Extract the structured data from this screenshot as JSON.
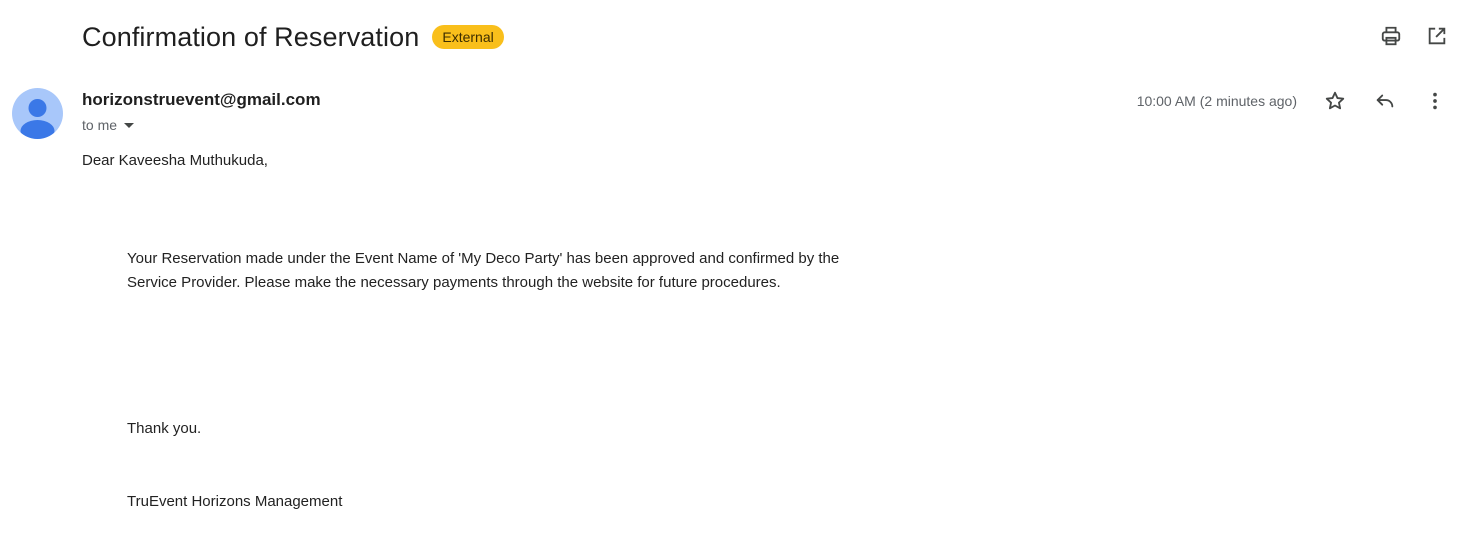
{
  "email": {
    "subject": "Confirmation of Reservation",
    "badge": "External",
    "sender": "horizonstruevent@gmail.com",
    "recipient": "to me",
    "timestamp": "10:00 AM (2 minutes ago)",
    "body": {
      "greeting": "Dear Kaveesha Muthukuda,",
      "paragraph_line1": "Your Reservation made under the Event Name of 'My Deco Party' has been approved and confirmed by the",
      "paragraph_line2": "Service Provider. Please make the necessary payments through the website for future procedures.",
      "closing": "Thank you.",
      "signature": "TruEvent Horizons Management"
    }
  },
  "icons": {
    "print": "print-icon",
    "open_new_window": "open-in-new-icon",
    "star": "star-icon",
    "reply": "reply-icon",
    "more": "more-vert-icon",
    "avatar": "person-icon",
    "recipient_dropdown": "caret-down-icon"
  },
  "colors": {
    "badge_background": "#f9bf1b",
    "avatar_background": "#a8c7fa",
    "avatar_figure": "#3b78e7",
    "text_primary": "#1f1f1f",
    "text_secondary": "#5f6368",
    "icon": "#444746"
  }
}
